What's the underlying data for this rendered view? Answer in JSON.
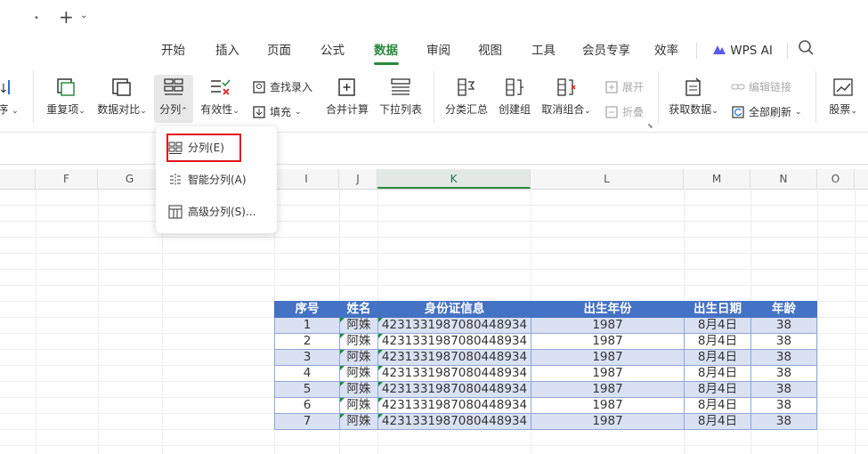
{
  "titlebar": {
    "plus": "+",
    "plus_dropdown": "⌄",
    "tab_dot": "•"
  },
  "menu": {
    "items": [
      "开始",
      "插入",
      "页面",
      "公式",
      "数据",
      "审阅",
      "视图",
      "工具",
      "会员专享",
      "效率"
    ],
    "active": "数据",
    "wps_ai": "WPS AI"
  },
  "ribbon": {
    "sort_partial": "序",
    "duplicate": "重复项",
    "compare": "数据对比",
    "split": "分列",
    "validity": "有效性",
    "find_entry": "查找录入",
    "fill": "填充",
    "merge_calc": "合并计算",
    "dropdown_list": "下拉列表",
    "subtotal": "分类汇总",
    "create_group": "创建组",
    "ungroup": "取消组合",
    "expand": "展开",
    "collapse": "折叠",
    "get_data": "获取数据",
    "edit_links": "编辑链接",
    "refresh_all": "全部刷新",
    "stocks": "股票"
  },
  "split_menu": {
    "items": [
      "分列(E)",
      "智能分列(A)",
      "高级分列(S)..."
    ]
  },
  "columns": [
    "F",
    "G",
    "I",
    "J",
    "K",
    "L",
    "M",
    "N",
    "O"
  ],
  "selected_column": "K",
  "table": {
    "headers": [
      "序号",
      "姓名",
      "身份证信息",
      "出生年份",
      "出生日期",
      "年龄"
    ],
    "rows": [
      [
        "1",
        "阿姝",
        "4231331987080448934",
        "1987",
        "8月4日",
        "38"
      ],
      [
        "2",
        "阿姝",
        "4231331987080448934",
        "1987",
        "8月4日",
        "38"
      ],
      [
        "3",
        "阿姝",
        "4231331987080448934",
        "1987",
        "8月4日",
        "38"
      ],
      [
        "4",
        "阿姝",
        "4231331987080448934",
        "1987",
        "8月4日",
        "38"
      ],
      [
        "5",
        "阿姝",
        "4231331987080448934",
        "1987",
        "8月4日",
        "38"
      ],
      [
        "6",
        "阿姝",
        "4231331987080448934",
        "1987",
        "8月4日",
        "38"
      ],
      [
        "7",
        "阿姝",
        "4231331987080448934",
        "1987",
        "8月4日",
        "38"
      ]
    ]
  },
  "colors": {
    "accent": "#2a8a3e",
    "table_header": "#4472c4",
    "table_band": "#d9e1f2",
    "highlight": "#e0141e"
  }
}
